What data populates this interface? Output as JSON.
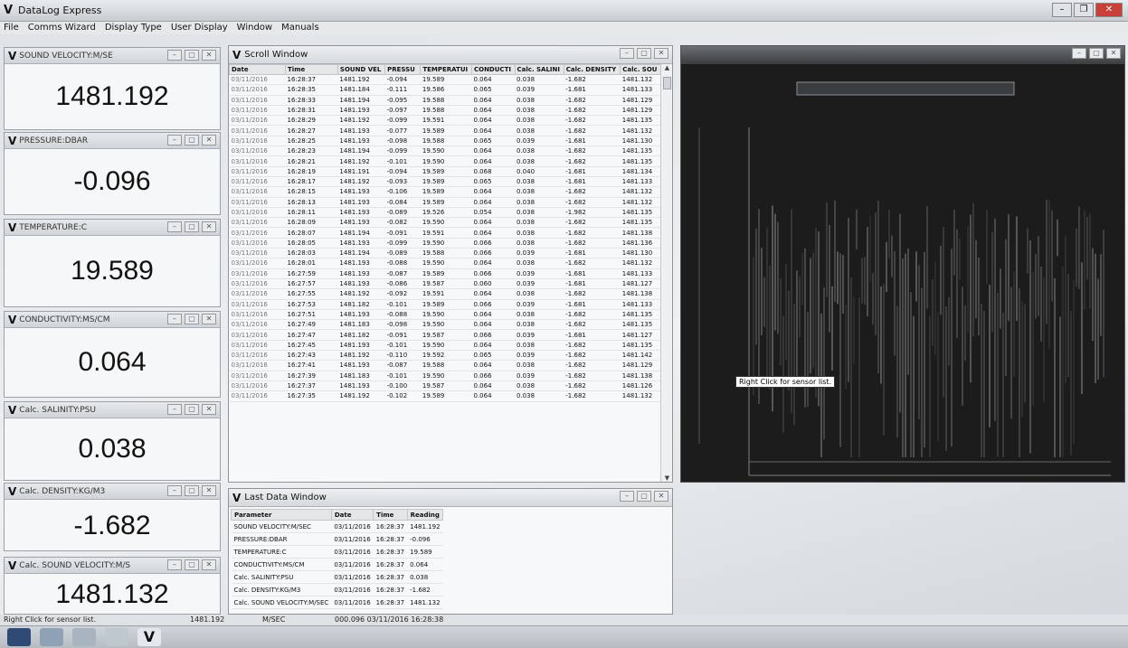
{
  "window": {
    "title": "DataLog Express",
    "logo": "V"
  },
  "menu": [
    "File",
    "Comms Wizard",
    "Display Type",
    "User Display",
    "Window",
    "Manuals"
  ],
  "sensors": [
    {
      "label": "SOUND VELOCITY:M/SE",
      "value": "1481.192"
    },
    {
      "label": "PRESSURE:DBAR",
      "value": "-0.096"
    },
    {
      "label": "TEMPERATURE:C",
      "value": "19.589"
    },
    {
      "label": "CONDUCTIVITY:MS/CM",
      "value": "0.064"
    },
    {
      "label": "Calc. SALINITY:PSU",
      "value": "0.038"
    },
    {
      "label": "Calc. DENSITY:KG/M3",
      "value": "-1.682"
    },
    {
      "label": "Calc. SOUND VELOCITY:M/S",
      "value": "1481.132"
    }
  ],
  "scroll_window": {
    "title": "Scroll Window",
    "columns": [
      "Date",
      "Time",
      "SOUND VEL",
      "PRESSU",
      "TEMPERATUI",
      "CONDUCTI",
      "Calc. SALINI",
      "Calc. DENSITY",
      "Calc. SOU"
    ],
    "rows": [
      [
        "03/11/2016",
        "16:28:37",
        "1481.192",
        "-0.094",
        "19.589",
        "0.064",
        "0.038",
        "-1.682",
        "1481.132"
      ],
      [
        "03/11/2016",
        "16:28:35",
        "1481.184",
        "-0.111",
        "19.586",
        "0.065",
        "0.039",
        "-1.681",
        "1481.133"
      ],
      [
        "03/11/2016",
        "16:28:33",
        "1481.194",
        "-0.095",
        "19.588",
        "0.064",
        "0.038",
        "-1.682",
        "1481.129"
      ],
      [
        "03/11/2016",
        "16:28:31",
        "1481.193",
        "-0.097",
        "19.588",
        "0.064",
        "0.038",
        "-1.682",
        "1481.129"
      ],
      [
        "03/11/2016",
        "16:28:29",
        "1481.192",
        "-0.099",
        "19.591",
        "0.064",
        "0.038",
        "-1.682",
        "1481.135"
      ],
      [
        "03/11/2016",
        "16:28:27",
        "1481.193",
        "-0.077",
        "19.589",
        "0.064",
        "0.038",
        "-1.682",
        "1481.132"
      ],
      [
        "03/11/2016",
        "16:28:25",
        "1481.193",
        "-0.098",
        "19.588",
        "0.065",
        "0.039",
        "-1.681",
        "1481.130"
      ],
      [
        "03/11/2016",
        "16:28:23",
        "1481.194",
        "-0.099",
        "19.590",
        "0.064",
        "0.038",
        "-1.682",
        "1481.135"
      ],
      [
        "03/11/2016",
        "16:28:21",
        "1481.192",
        "-0.101",
        "19.590",
        "0.064",
        "0.038",
        "-1.682",
        "1481.135"
      ],
      [
        "03/11/2016",
        "16:28:19",
        "1481.191",
        "-0.094",
        "19.589",
        "0.068",
        "0.040",
        "-1.681",
        "1481.134"
      ],
      [
        "03/11/2016",
        "16:28:17",
        "1481.192",
        "-0.093",
        "19.589",
        "0.065",
        "0.038",
        "-1.681",
        "1481.133"
      ],
      [
        "03/11/2016",
        "16:28:15",
        "1481.193",
        "-0.106",
        "19.589",
        "0.064",
        "0.038",
        "-1.682",
        "1481.132"
      ],
      [
        "03/11/2016",
        "16:28:13",
        "1481.193",
        "-0.084",
        "19.589",
        "0.064",
        "0.038",
        "-1.682",
        "1481.132"
      ],
      [
        "03/11/2016",
        "16:28:11",
        "1481.193",
        "-0.089",
        "19.526",
        "0.054",
        "0.038",
        "-1.982",
        "1481.135"
      ],
      [
        "03/11/2016",
        "16:28:09",
        "1481.193",
        "-0.082",
        "19.590",
        "0.064",
        "0.038",
        "-1.682",
        "1481.135"
      ],
      [
        "03/11/2016",
        "16:28:07",
        "1481.194",
        "-0.091",
        "19.591",
        "0.064",
        "0.038",
        "-1.682",
        "1481.138"
      ],
      [
        "03/11/2016",
        "16:28:05",
        "1481.193",
        "-0.099",
        "19.590",
        "0.066",
        "0.038",
        "-1.682",
        "1481.136"
      ],
      [
        "03/11/2016",
        "16:28:03",
        "1481.194",
        "-0.089",
        "19.588",
        "0.066",
        "0.039",
        "-1.681",
        "1481.130"
      ],
      [
        "03/11/2016",
        "16:28:01",
        "1481.193",
        "-0.088",
        "19.590",
        "0.064",
        "0.038",
        "-1.682",
        "1481.132"
      ],
      [
        "03/11/2016",
        "16:27:59",
        "1481.193",
        "-0.087",
        "19.589",
        "0.066",
        "0.039",
        "-1.681",
        "1481.133"
      ],
      [
        "03/11/2016",
        "16:27:57",
        "1481.193",
        "-0.086",
        "19.587",
        "0.060",
        "0.039",
        "-1.681",
        "1481.127"
      ],
      [
        "03/11/2016",
        "16:27:55",
        "1481.192",
        "-0.092",
        "19.591",
        "0.064",
        "0.038",
        "-1.682",
        "1481.138"
      ],
      [
        "03/11/2016",
        "16:27:53",
        "1481.182",
        "-0.101",
        "19.589",
        "0.066",
        "0.039",
        "-1.681",
        "1481.133"
      ],
      [
        "03/11/2016",
        "16:27:51",
        "1481.193",
        "-0.088",
        "19.590",
        "0.064",
        "0.038",
        "-1.682",
        "1481.135"
      ],
      [
        "03/11/2016",
        "16:27:49",
        "1481.183",
        "-0.098",
        "19.590",
        "0.064",
        "0.038",
        "-1.682",
        "1481.135"
      ],
      [
        "03/11/2016",
        "16:27:47",
        "1481.182",
        "-0.091",
        "19.587",
        "0.066",
        "0.039",
        "-1.681",
        "1481.127"
      ],
      [
        "03/11/2016",
        "16:27:45",
        "1481.193",
        "-0.101",
        "19.590",
        "0.064",
        "0.038",
        "-1.682",
        "1481.135"
      ],
      [
        "03/11/2016",
        "16:27:43",
        "1481.192",
        "-0.110",
        "19.592",
        "0.065",
        "0.039",
        "-1.682",
        "1481.142"
      ],
      [
        "03/11/2016",
        "16:27:41",
        "1481.193",
        "-0.087",
        "19.588",
        "0.064",
        "0.038",
        "-1.682",
        "1481.129"
      ],
      [
        "03/11/2016",
        "16:27:39",
        "1481.183",
        "-0.101",
        "19.590",
        "0.066",
        "0.039",
        "-1.682",
        "1481.138"
      ],
      [
        "03/11/2016",
        "16:27:37",
        "1481.193",
        "-0.100",
        "19.587",
        "0.064",
        "0.038",
        "-1.682",
        "1481.126"
      ],
      [
        "03/11/2016",
        "16:27:35",
        "1481.192",
        "-0.102",
        "19.589",
        "0.064",
        "0.038",
        "-1.682",
        "1481.132"
      ]
    ]
  },
  "last_data_window": {
    "title": "Last Data Window",
    "columns": [
      "Parameter",
      "Date",
      "Time",
      "Reading"
    ],
    "rows": [
      [
        "SOUND VELOCITY:M/SEC",
        "03/11/2016",
        "16:28:37",
        "1481.192"
      ],
      [
        "PRESSURE:DBAR",
        "03/11/2016",
        "16:28:37",
        "-0.096"
      ],
      [
        "TEMPERATURE:C",
        "03/11/2016",
        "16:28:37",
        "19.589"
      ],
      [
        "CONDUCTIVITY:MS/CM",
        "03/11/2016",
        "16:28:37",
        "0.064"
      ],
      [
        "Calc. SALINITY:PSU",
        "03/11/2016",
        "16:28:37",
        "0.038"
      ],
      [
        "Calc. DENSITY:KG/M3",
        "03/11/2016",
        "16:28:37",
        "-1.682"
      ],
      [
        "Calc. SOUND VELOCITY:M/SEC",
        "03/11/2016",
        "16:28:37",
        "1481.132"
      ]
    ]
  },
  "graph_window": {
    "tooltip": "Right Click for sensor list."
  },
  "statusbar": {
    "hint": "Right Click for sensor list.",
    "reading": "1481.192",
    "unit": "M/SEC",
    "stamp": "000.096 03/11/2016 16:28:38"
  },
  "icons": [
    "minimize-icon",
    "restore-icon",
    "close-icon",
    "datalog-logo-icon"
  ],
  "colors": {
    "graph_bg": "#1c1c1c",
    "trace": "#e6e6e6",
    "accent_close": "#c7413a"
  }
}
